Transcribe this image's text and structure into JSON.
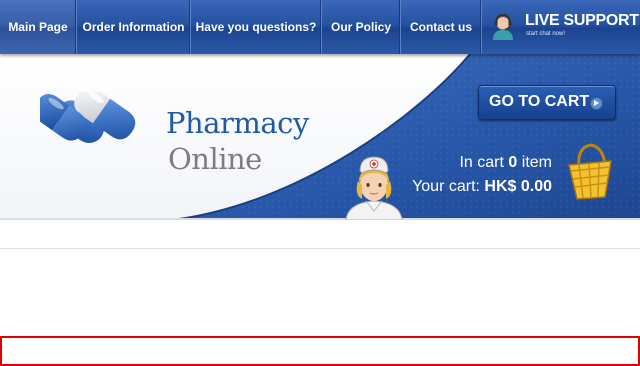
{
  "nav": {
    "items": [
      {
        "label": "Main Page"
      },
      {
        "label": "Order Information"
      },
      {
        "label": "Have you questions?"
      },
      {
        "label": "Our Policy"
      },
      {
        "label": "Contact us"
      }
    ],
    "live_support": {
      "title": "LIVE SUPPORT",
      "subtitle": "start chat now!",
      "icon": "support-agent-icon"
    }
  },
  "header": {
    "brand_line1": "Pharmacy",
    "brand_line2": "Online",
    "logo_icon": "pill-capsule-icon",
    "goto_cart_label": "GO TO CART",
    "cart": {
      "in_cart_prefix": "In cart",
      "item_count": "0",
      "in_cart_suffix": "item",
      "total_prefix": "Your cart:",
      "total": "HK$ 0.00"
    },
    "basket_icon": "shopping-basket-icon",
    "nurse_icon": "nurse-illustration"
  },
  "colors": {
    "nav_blue": "#24509f",
    "banner_blue": "#2a5db0",
    "brand_blue": "#1f5aa6",
    "brand_grey": "#7d7d7d",
    "alert_red": "#e00000"
  }
}
